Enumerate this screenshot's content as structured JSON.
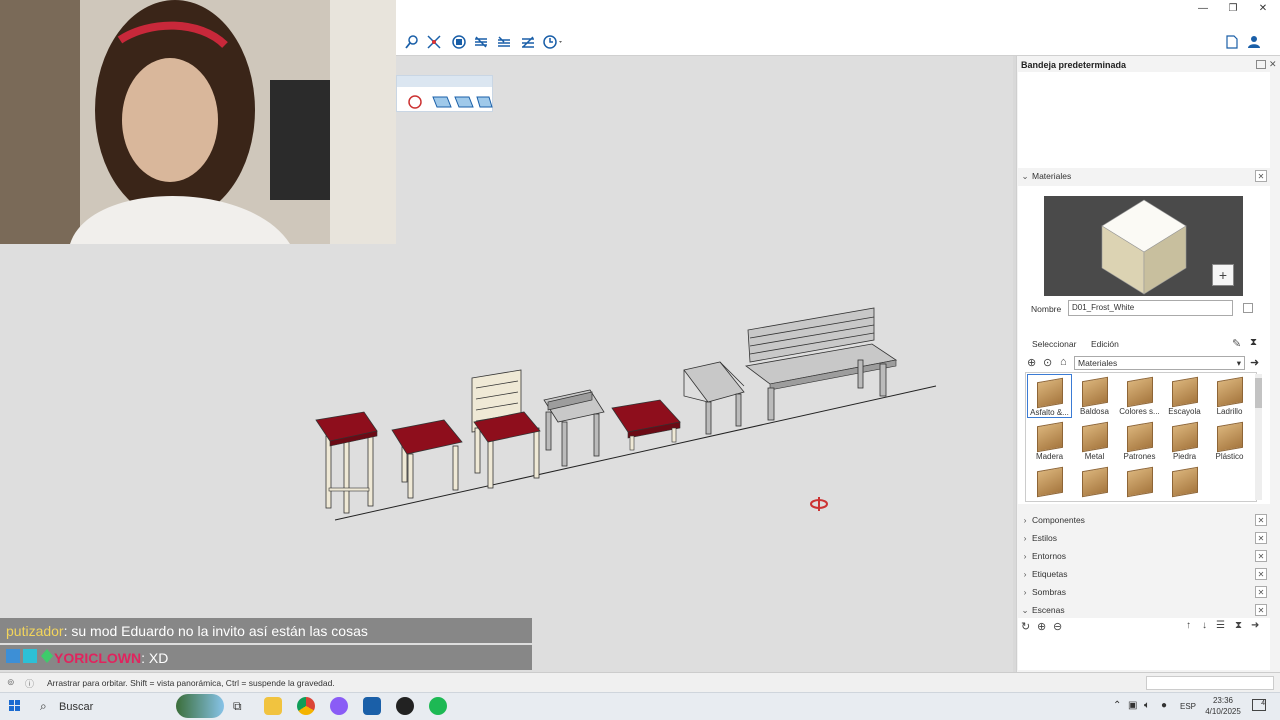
{
  "window": {
    "minimize": "—",
    "restore": "❐",
    "close": "✕"
  },
  "toolbar": {
    "icons": [
      "zoom-icon",
      "zoom-extents-icon",
      "view-iso-icon",
      "view-top-icon",
      "view-front-icon",
      "view-right-icon",
      "geo-location-icon"
    ],
    "right_icons": [
      "new-file-icon",
      "user-icon"
    ]
  },
  "tray": {
    "title": "Bandeja predeterminada",
    "materials": {
      "header": "Materiales",
      "name_label": "Nombre",
      "name_value": "D01_Frost_White",
      "tab_select": "Seleccionar",
      "tab_edit": "Edición",
      "library": "Materiales",
      "items": [
        "Asfalto &...",
        "Baldosa",
        "Colores s...",
        "Escayola",
        "Ladrillo",
        "Madera",
        "Metal",
        "Patrones",
        "Piedra",
        "Plástico",
        "",
        "",
        "",
        ""
      ]
    },
    "sections": [
      "Componentes",
      "Estilos",
      "Entornos",
      "Etiquetas",
      "Sombras",
      "Escenas"
    ],
    "close_glyph": "✕"
  },
  "chat": [
    {
      "user": "putizador",
      "text": " : su mod Eduardo no la invito así están las cosas",
      "user_color": "#f2d45c"
    },
    {
      "user": "YORICLOWN",
      "text": " : XD",
      "user_color": "#e0245e"
    }
  ],
  "status": {
    "text": "Arrastrar para orbitar. Shift = vista panorámica, Ctrl = suspende la gravedad."
  },
  "taskbar": {
    "search": "Buscar",
    "lang": "ESP",
    "time": "23:36",
    "date": "4/10/2025",
    "notif": "4"
  },
  "colors": {
    "cushion": "#8e0e1c",
    "wood": "#efe9d6",
    "accent": "#1a5fa8"
  }
}
